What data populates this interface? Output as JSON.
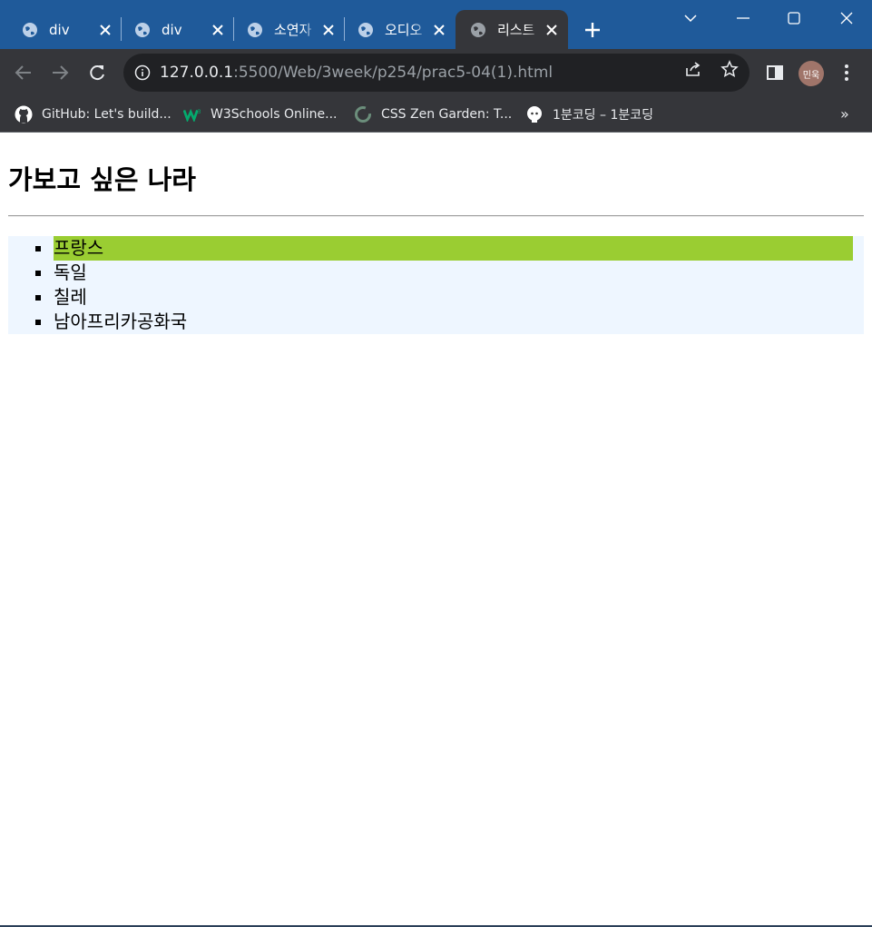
{
  "browser": {
    "tabs": [
      {
        "title": "div",
        "active": false
      },
      {
        "title": "div",
        "active": false
      },
      {
        "title": "소연자",
        "active": false
      },
      {
        "title": "오디오",
        "active": false
      },
      {
        "title": "리스트",
        "active": true
      }
    ],
    "address": {
      "host": "127.0.0.1",
      "path": ":5500/Web/3week/p254/prac5-04(1).html"
    },
    "profile_label": "민욱",
    "bookmarks": [
      {
        "label": "GitHub: Let's build...",
        "icon": "github-icon"
      },
      {
        "label": "W3Schools Online...",
        "icon": "w3schools-icon"
      },
      {
        "label": "CSS Zen Garden: T...",
        "icon": "zen-garden-icon"
      },
      {
        "label": "1분코딩 – 1분코딩",
        "icon": "1bun-coding-icon"
      }
    ],
    "bookmarks_overflow": "»"
  },
  "page": {
    "heading": "가보고 싶은 나라",
    "countries": [
      {
        "name": "프랑스",
        "highlighted": true
      },
      {
        "name": "독일",
        "highlighted": false
      },
      {
        "name": "칠레",
        "highlighted": false
      },
      {
        "name": "남아프리카공화국",
        "highlighted": false
      }
    ],
    "colors": {
      "list_background": "#eef6ff",
      "highlight": "#9acd32",
      "tabstrip": "#1f5a9a",
      "toolbar": "#35363a"
    }
  }
}
